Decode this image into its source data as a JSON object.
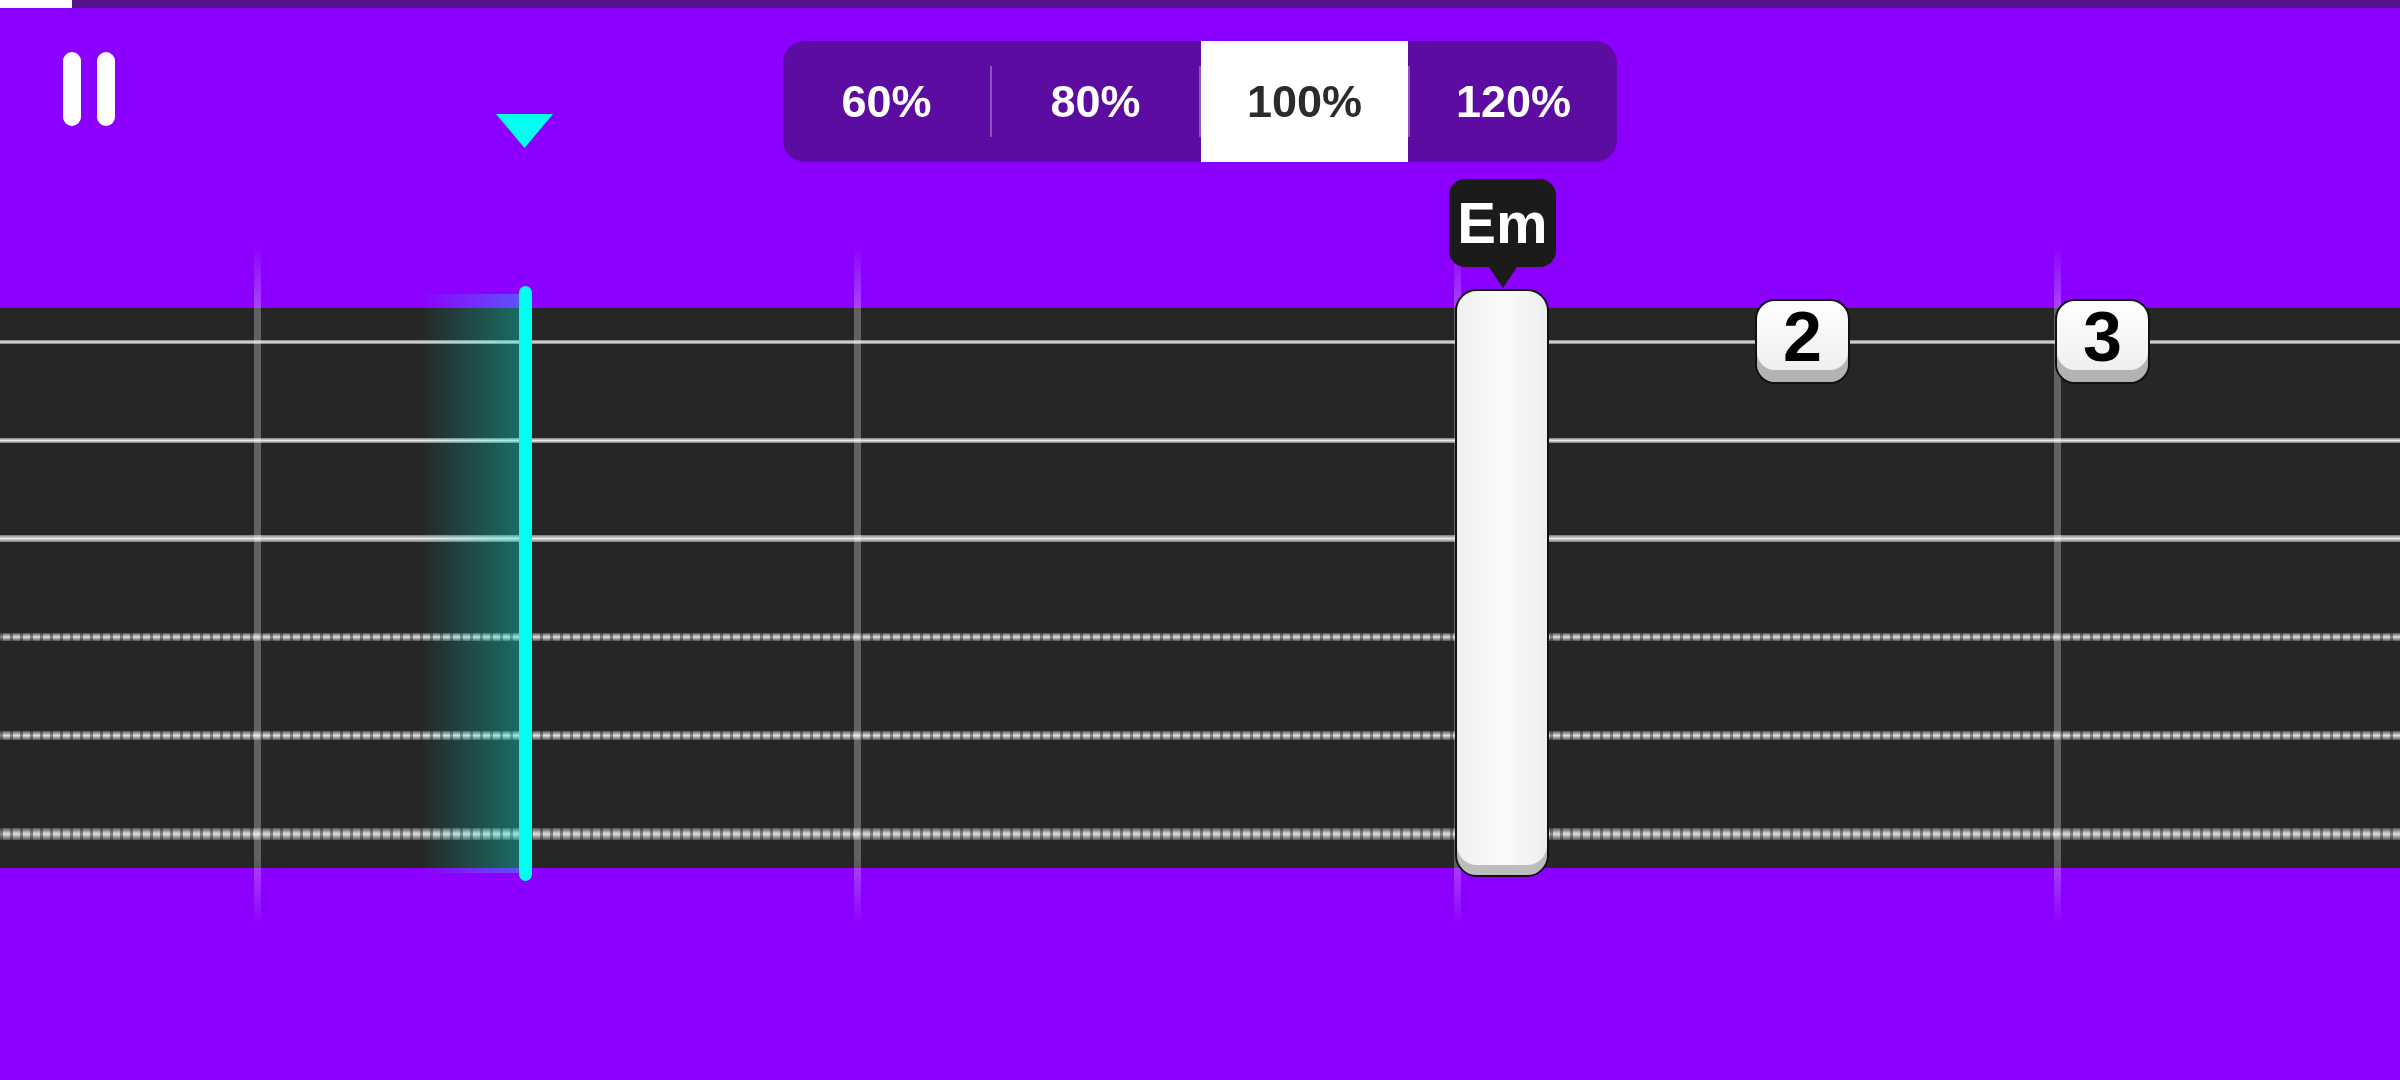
{
  "player": {
    "playing": true,
    "progress": {
      "level": 0.03
    }
  },
  "speed_options": [
    {
      "label": "60%",
      "selected": false
    },
    {
      "label": "80%",
      "selected": false
    },
    {
      "label": "100%",
      "selected": true
    },
    {
      "label": "120%",
      "selected": false
    }
  ],
  "fretboard": {
    "strings": [
      {
        "kind": "plain"
      },
      {
        "kind": "plain"
      },
      {
        "kind": "plain"
      },
      {
        "kind": "wound"
      },
      {
        "kind": "wound"
      },
      {
        "kind": "wound"
      }
    ]
  },
  "notes": [
    {
      "kind": "chord",
      "label": "Em"
    },
    {
      "kind": "fret",
      "label": "2"
    },
    {
      "kind": "fret",
      "label": "3"
    }
  ]
}
